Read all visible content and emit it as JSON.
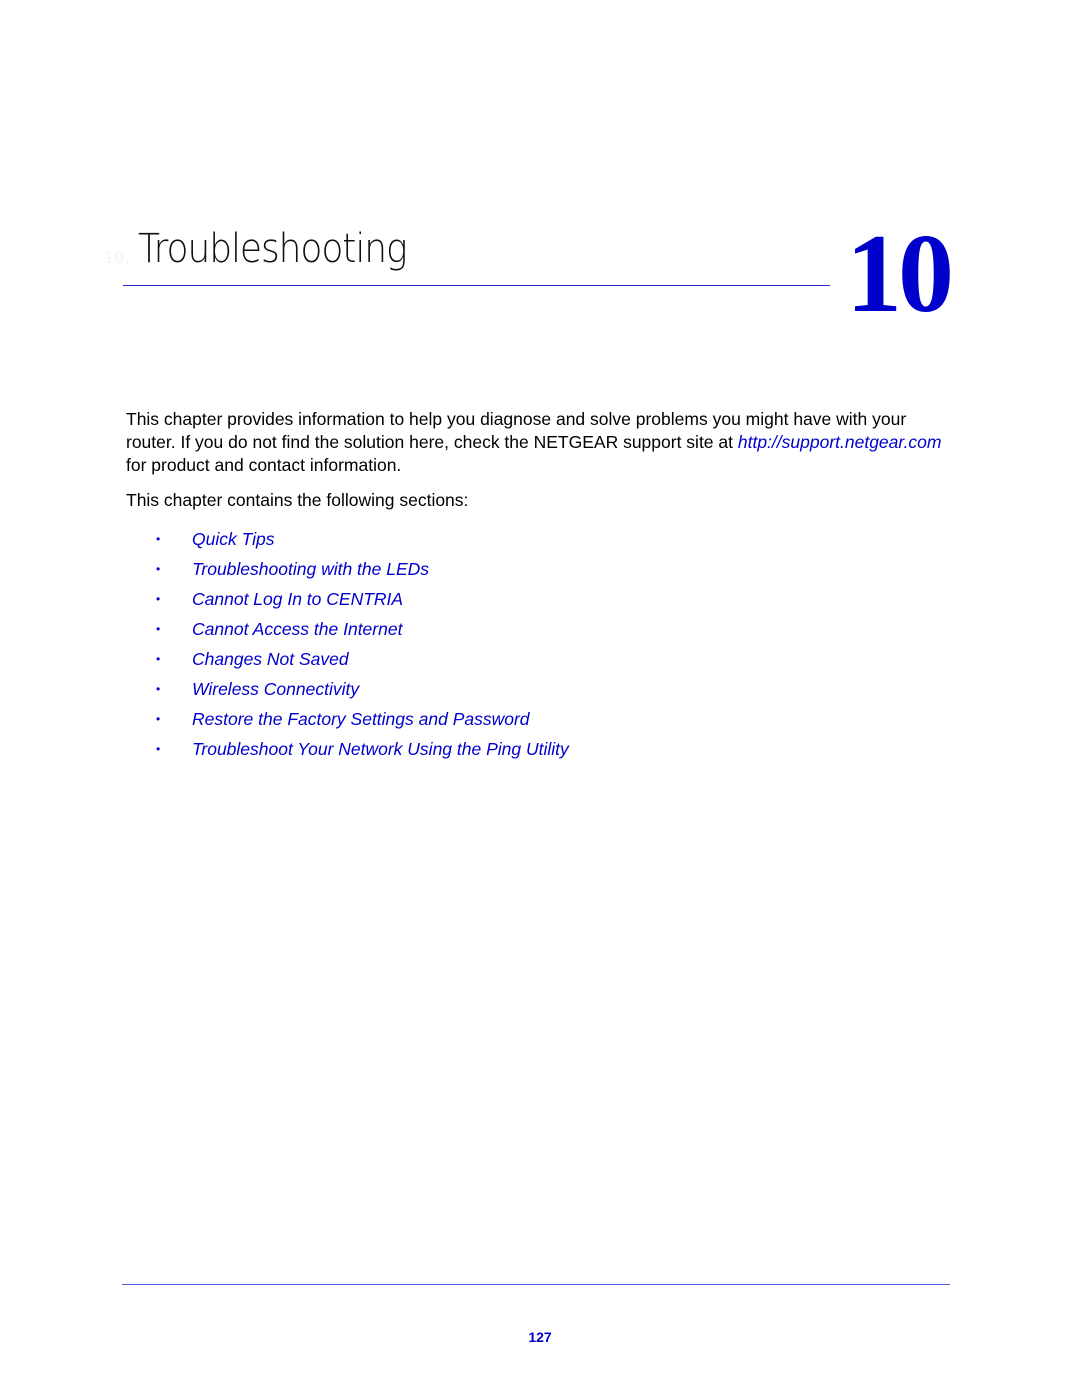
{
  "chapter": {
    "prefix": "10.",
    "title": "Troubleshooting",
    "number": "10"
  },
  "intro": {
    "text_before_link": "This chapter provides information to help you diagnose and solve problems you might have with your router. If you do not find the solution here, check the NETGEAR support site at ",
    "link": "http://support.netgear.com",
    "text_after_link": " for product and contact information."
  },
  "sections_intro": "This chapter contains the following sections:",
  "sections": [
    {
      "bullet": "•",
      "label": "Quick Tips"
    },
    {
      "bullet": "•",
      "label": "Troubleshooting with the LEDs"
    },
    {
      "bullet": "•",
      "label": "Cannot Log In to CENTRIA"
    },
    {
      "bullet": "•",
      "label": "Cannot Access the Internet"
    },
    {
      "bullet": "•",
      "label": "Changes Not Saved"
    },
    {
      "bullet": "•",
      "label": "Wireless Connectivity"
    },
    {
      "bullet": "•",
      "label": "Restore the Factory Settings and Password"
    },
    {
      "bullet": "•",
      "label": "Troubleshoot Your Network Using the Ping Utility"
    }
  ],
  "footer": {
    "page_number": "127"
  },
  "colors": {
    "accent": "#0000cc",
    "rule": "#2b2bd6"
  }
}
